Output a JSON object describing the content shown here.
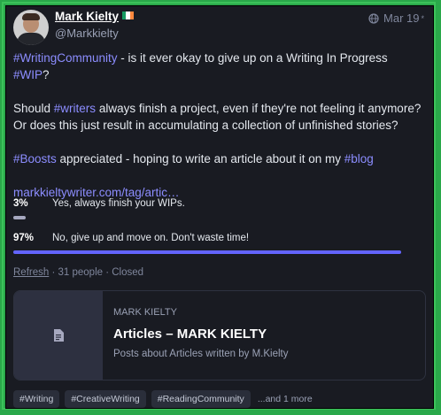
{
  "post": {
    "display_name": "Mark Kielty",
    "handle": "@Markkielty",
    "date": "Mar 19",
    "edited_mark": "*",
    "visibility_icon": "globe-icon",
    "flag_colors": [
      "#169b62",
      "#ffffff",
      "#ff883e"
    ],
    "paragraphs": [
      [
        {
          "text": "#WritingCommunity",
          "tag": true
        },
        {
          "text": " - is it ever okay to give up on a Writing In Progress ",
          "tag": false
        },
        {
          "text": "#WIP",
          "tag": true
        },
        {
          "text": "?",
          "tag": false
        }
      ],
      [
        {
          "text": "Should ",
          "tag": false
        },
        {
          "text": "#writers",
          "tag": true
        },
        {
          "text": " always finish a project, even if they're not feeling it anymore? Or does this just result in accumulating a collection of unfinished stories?",
          "tag": false
        }
      ],
      [
        {
          "text": "#Boosts",
          "tag": true
        },
        {
          "text": " appreciated - hoping to write an article about it on my ",
          "tag": false
        },
        {
          "text": "#blog",
          "tag": true
        }
      ],
      [
        {
          "text": "markkieltywriter.com/tag/artic…",
          "tag": true
        }
      ]
    ]
  },
  "poll": {
    "options": [
      {
        "percent_label": "3%",
        "label": "Yes, always finish your WIPs.",
        "fraction": 0.03,
        "color": "#a6a8bf"
      },
      {
        "percent_label": "97%",
        "label": "No, give up and move on. Don't waste time!",
        "fraction": 0.97,
        "color": "#6364ff"
      }
    ],
    "refresh_label": "Refresh",
    "summary": " · 31 people · Closed"
  },
  "link_card": {
    "provider": "MARK KIELTY",
    "title": "Articles – MARK KIELTY",
    "description": "Posts about Articles written by M.Kielty",
    "icon": "document-icon"
  },
  "hashtags": [
    "#Writing",
    "#CreativeWriting",
    "#ReadingCommunity"
  ],
  "more_label": "...and 1 more"
}
